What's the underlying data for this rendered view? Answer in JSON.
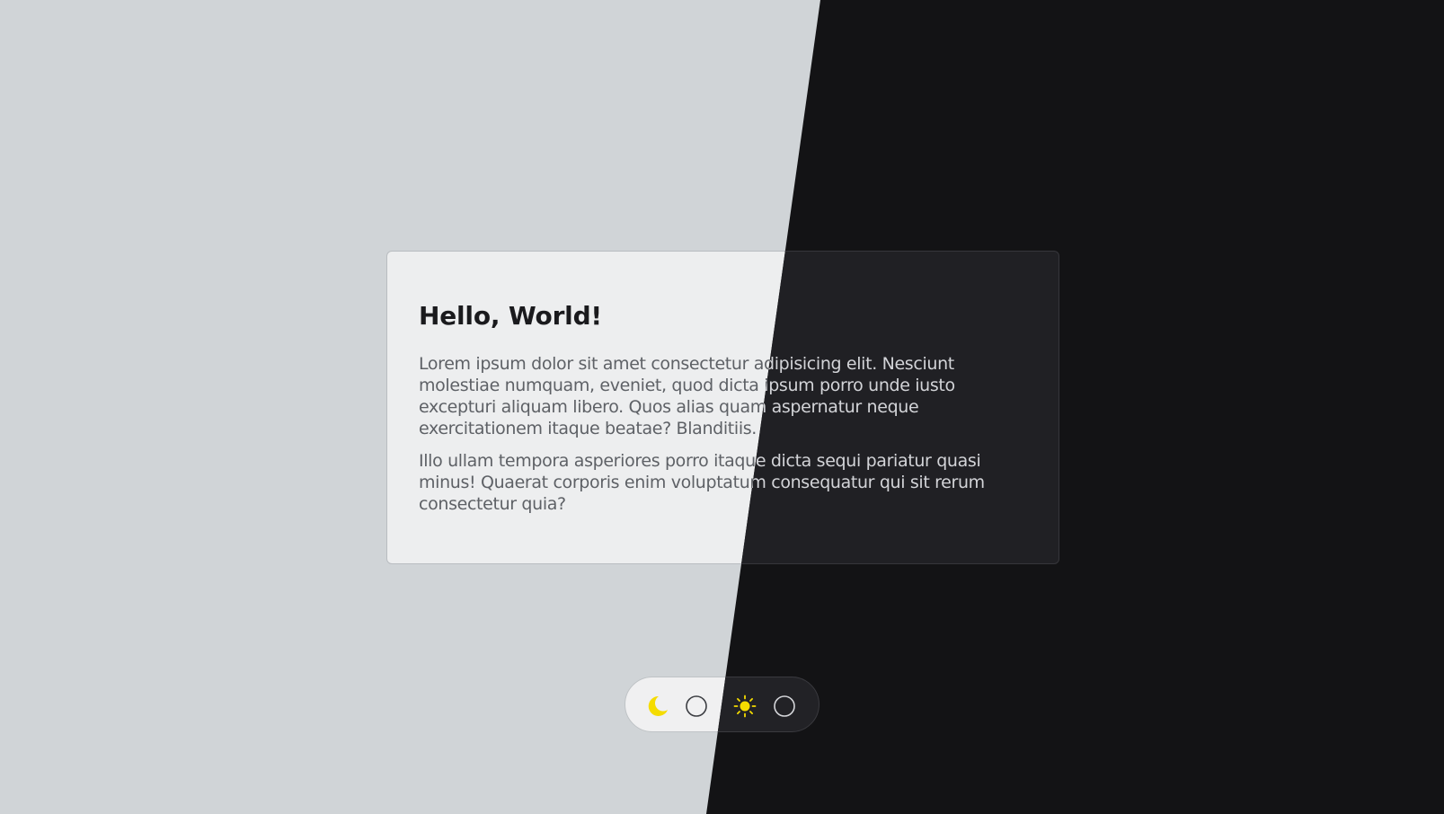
{
  "card": {
    "title": "Hello, World!",
    "paragraphs": [
      "Lorem ipsum dolor sit amet consectetur adipisicing elit. Nesciunt molestiae numquam, eveniet, quod dicta ipsum porro unde iusto excepturi aliquam libero. Quos alias quam aspernatur neque exercitationem itaque beatae? Blanditiis.",
      "Illo ullam tempora asperiores porro itaque dicta sequi pariatur quasi minus! Quaerat corporis enim voluptatum consequatur qui sit rerum consectetur quia?"
    ]
  },
  "theme_toggle": {
    "options": [
      {
        "icon": "moon-icon",
        "selected": false
      },
      {
        "icon": "sun-icon",
        "selected": false
      }
    ]
  },
  "colors": {
    "light_background": "#d0d4d7",
    "dark_background": "#131315",
    "light_card": "#edeeef",
    "dark_card": "#202024",
    "icon_accent": "#f5dc00"
  }
}
